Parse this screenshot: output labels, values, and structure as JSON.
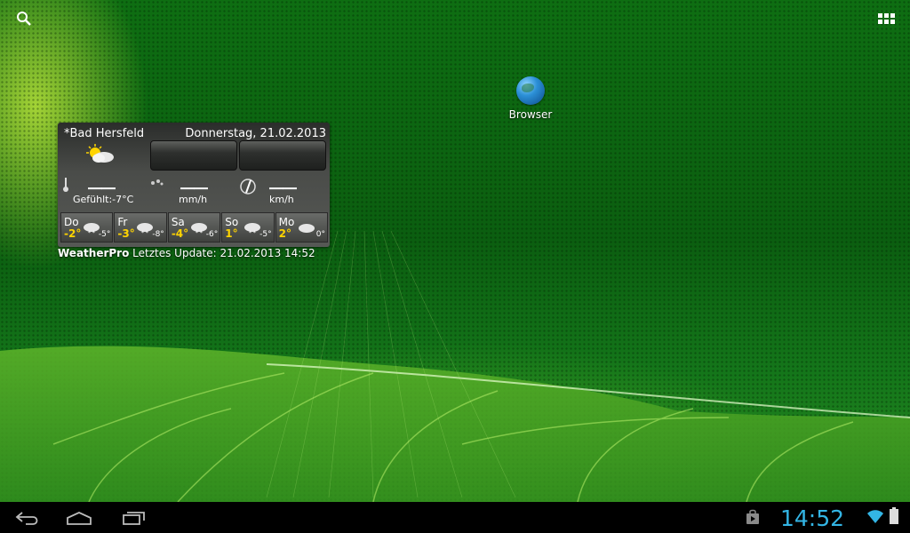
{
  "top": {
    "search_icon": "search-icon",
    "apps_icon": "all-apps-icon"
  },
  "shortcuts": [
    {
      "label": "Browser",
      "icon": "browser-globe-icon"
    }
  ],
  "weather_widget": {
    "city": "*Bad Hersfeld",
    "date": "Donnerstag, 21.02.2013",
    "feels_like": "Gefühlt:-7°C",
    "rain_unit": "mm/h",
    "wind_unit": "km/h",
    "forecast": [
      {
        "day": "Do",
        "high": "-2°",
        "low": "-5°"
      },
      {
        "day": "Fr",
        "high": "-3°",
        "low": "-8°"
      },
      {
        "day": "Sa",
        "high": "-4°",
        "low": "-6°"
      },
      {
        "day": "So",
        "high": "1°",
        "low": "-5°"
      },
      {
        "day": "Mo",
        "high": "2°",
        "low": "0°"
      }
    ],
    "footer_brand": "WeatherPro",
    "footer_update": " Letztes Update: 21.02.2013 14:52"
  },
  "navbar": {
    "clock": "14:52"
  },
  "colors": {
    "clock": "#33b5e5",
    "forecast_high": "#ffd400"
  }
}
